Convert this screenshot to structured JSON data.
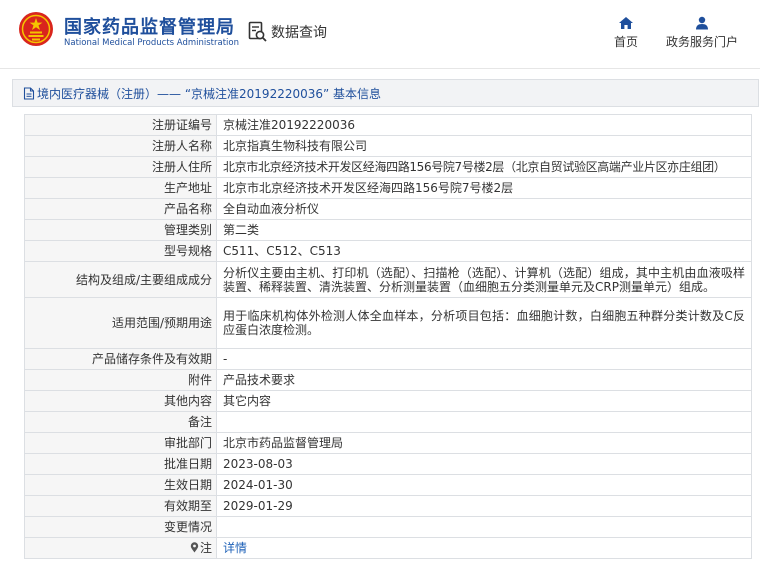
{
  "header": {
    "title_cn": "国家药品监督管理局",
    "title_en": "National Medical Products Administration",
    "data_query": "数据查询",
    "nav": [
      {
        "label": "首页",
        "icon": "home-icon"
      },
      {
        "label": "政务服务门户",
        "icon": "user-icon"
      }
    ]
  },
  "breadcrumb": "境内医疗器械（注册）—— “京械注准20192220036” 基本信息",
  "fields": [
    {
      "label": "注册证编号",
      "value": "京械注准20192220036"
    },
    {
      "label": "注册人名称",
      "value": "北京指真生物科技有限公司"
    },
    {
      "label": "注册人住所",
      "value": "北京市北京经济技术开发区经海四路156号院7号楼2层（北京自贸试验区高端产业片区亦庄组团）"
    },
    {
      "label": "生产地址",
      "value": "北京市北京经济技术开发区经海四路156号院7号楼2层"
    },
    {
      "label": "产品名称",
      "value": "全自动血液分析仪"
    },
    {
      "label": "管理类别",
      "value": "第二类"
    },
    {
      "label": "型号规格",
      "value": "C511、C512、C513"
    },
    {
      "label": "结构及组成/主要组成成分",
      "value": "分析仪主要由主机、打印机（选配）、扫描枪（选配）、计算机（选配）组成，其中主机由血液吸样装置、稀释装置、清洗装置、分析测量装置（血细胞五分类测量单元及CRP测量单元）组成。"
    },
    {
      "label": "适用范围/预期用途",
      "value": "用于临床机构体外检测人体全血样本，分析项目包括：血细胞计数，白细胞五种群分类计数及C反应蛋白浓度检测。"
    },
    {
      "label": "产品储存条件及有效期",
      "value": "-"
    },
    {
      "label": "附件",
      "value": "产品技术要求"
    },
    {
      "label": "其他内容",
      "value": "其它内容"
    },
    {
      "label": "备注",
      "value": ""
    },
    {
      "label": "审批部门",
      "value": "北京市药品监督管理局"
    },
    {
      "label": "批准日期",
      "value": "2023-08-03"
    },
    {
      "label": "生效日期",
      "value": "2024-01-30"
    },
    {
      "label": "有效期至",
      "value": "2029-01-29"
    },
    {
      "label": "变更情况",
      "value": ""
    },
    {
      "label": "注",
      "value": "详情"
    }
  ],
  "colors": {
    "brand": "#1f4f9c",
    "link": "#1f62b8",
    "emblem": "#d9251d"
  }
}
